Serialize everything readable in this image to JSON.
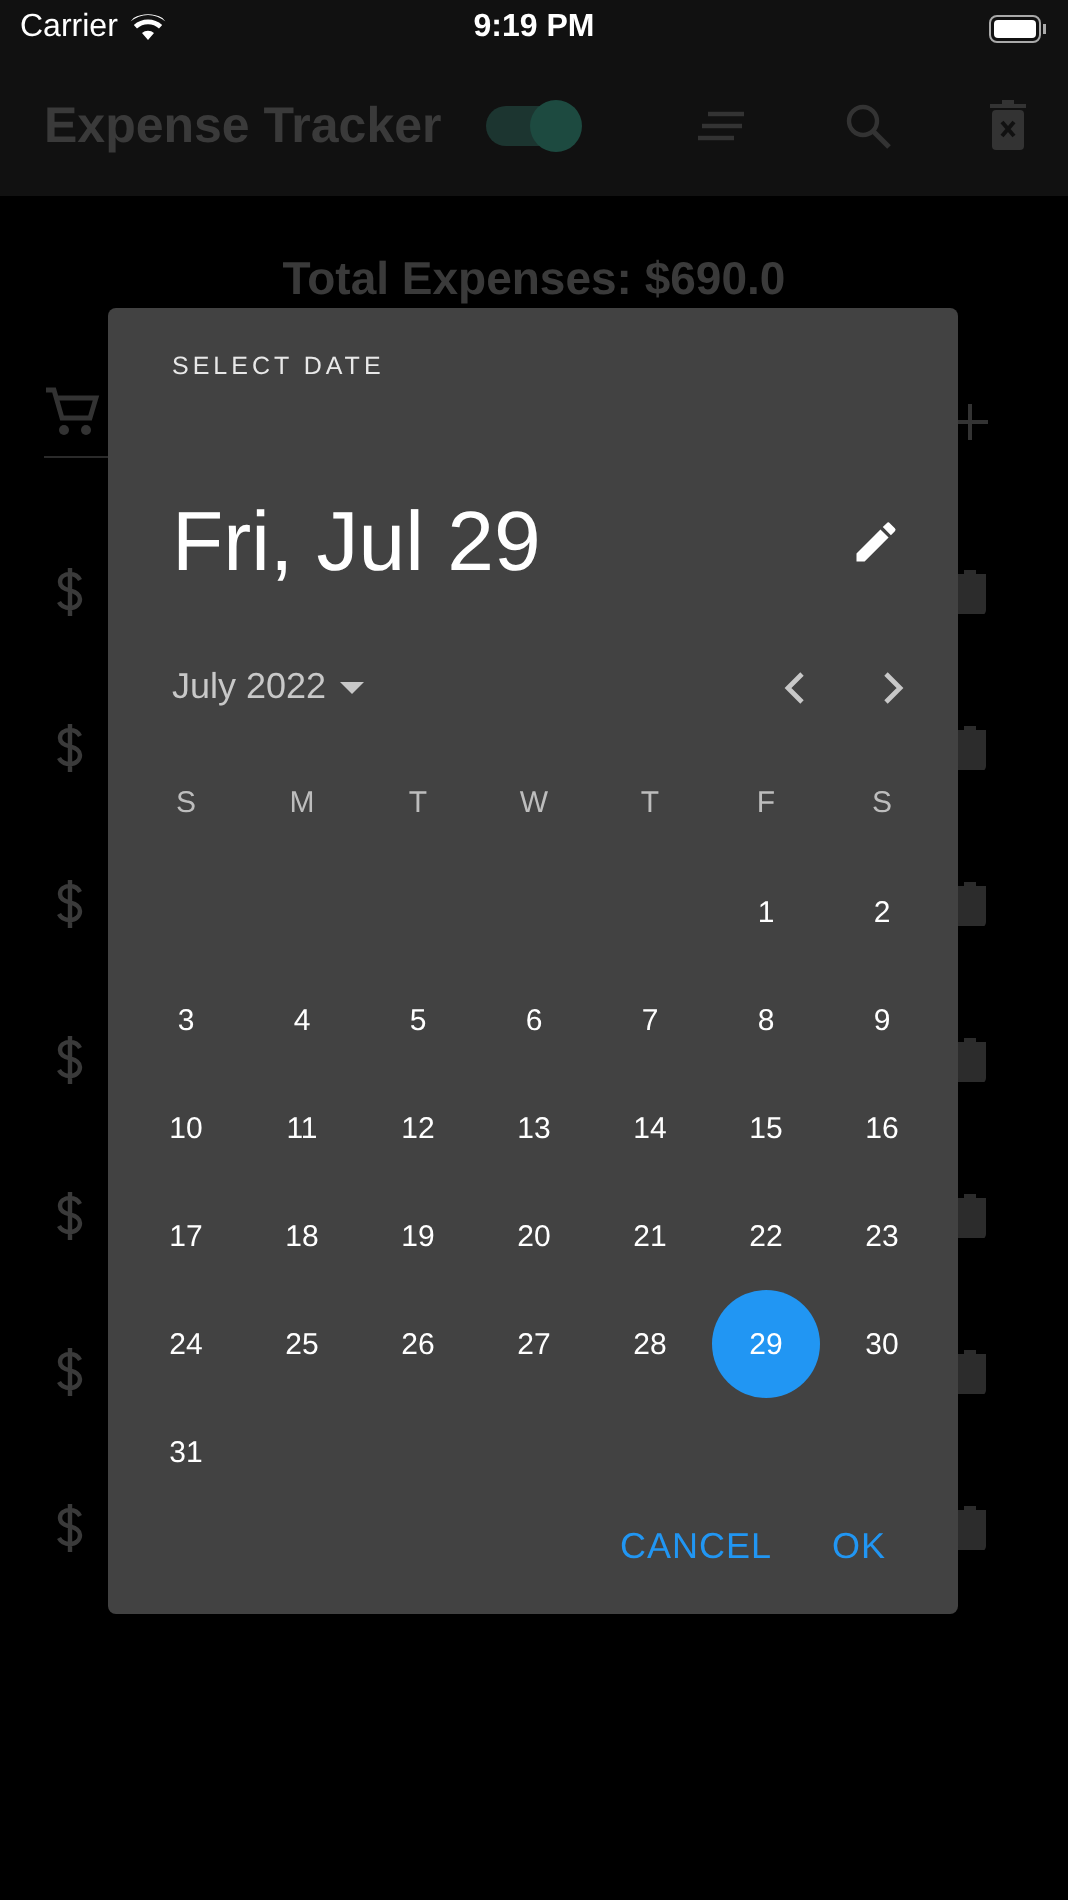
{
  "status_bar": {
    "carrier": "Carrier",
    "time": "9:19 PM"
  },
  "app_bar": {
    "title": "Expense Tracker",
    "theme_toggle": {
      "on": true
    }
  },
  "total": "Total Expenses: $690.0",
  "date_picker": {
    "heading": "SELECT DATE",
    "selected_date": "Fri, Jul 29",
    "month": "July 2022",
    "weekdays": [
      "S",
      "M",
      "T",
      "W",
      "T",
      "F",
      "S"
    ],
    "weeks": [
      {
        "kind": "tail",
        "days": [
          {
            "label": "1",
            "selected": false
          },
          {
            "label": "2",
            "selected": false
          }
        ]
      },
      {
        "kind": "head",
        "days": [
          {
            "label": "3",
            "selected": false
          },
          {
            "label": "4",
            "selected": false
          },
          {
            "label": "5",
            "selected": false
          },
          {
            "label": "6",
            "selected": false
          },
          {
            "label": "7",
            "selected": false
          },
          {
            "label": "8",
            "selected": false
          },
          {
            "label": "9",
            "selected": false
          }
        ]
      },
      {
        "kind": "head",
        "days": [
          {
            "label": "10",
            "selected": false
          },
          {
            "label": "11",
            "selected": false
          },
          {
            "label": "12",
            "selected": false
          },
          {
            "label": "13",
            "selected": false
          },
          {
            "label": "14",
            "selected": false
          },
          {
            "label": "15",
            "selected": false
          },
          {
            "label": "16",
            "selected": false
          }
        ]
      },
      {
        "kind": "head",
        "days": [
          {
            "label": "17",
            "selected": false
          },
          {
            "label": "18",
            "selected": false
          },
          {
            "label": "19",
            "selected": false
          },
          {
            "label": "20",
            "selected": false
          },
          {
            "label": "21",
            "selected": false
          },
          {
            "label": "22",
            "selected": false
          },
          {
            "label": "23",
            "selected": false
          }
        ]
      },
      {
        "kind": "head",
        "days": [
          {
            "label": "24",
            "selected": false
          },
          {
            "label": "25",
            "selected": false
          },
          {
            "label": "26",
            "selected": false
          },
          {
            "label": "27",
            "selected": false
          },
          {
            "label": "28",
            "selected": false
          },
          {
            "label": "29",
            "selected": true
          },
          {
            "label": "30",
            "selected": false
          }
        ]
      },
      {
        "kind": "head",
        "days": [
          {
            "label": "31",
            "selected": false
          }
        ]
      }
    ],
    "buttons": [
      "CANCEL",
      "OK"
    ]
  }
}
